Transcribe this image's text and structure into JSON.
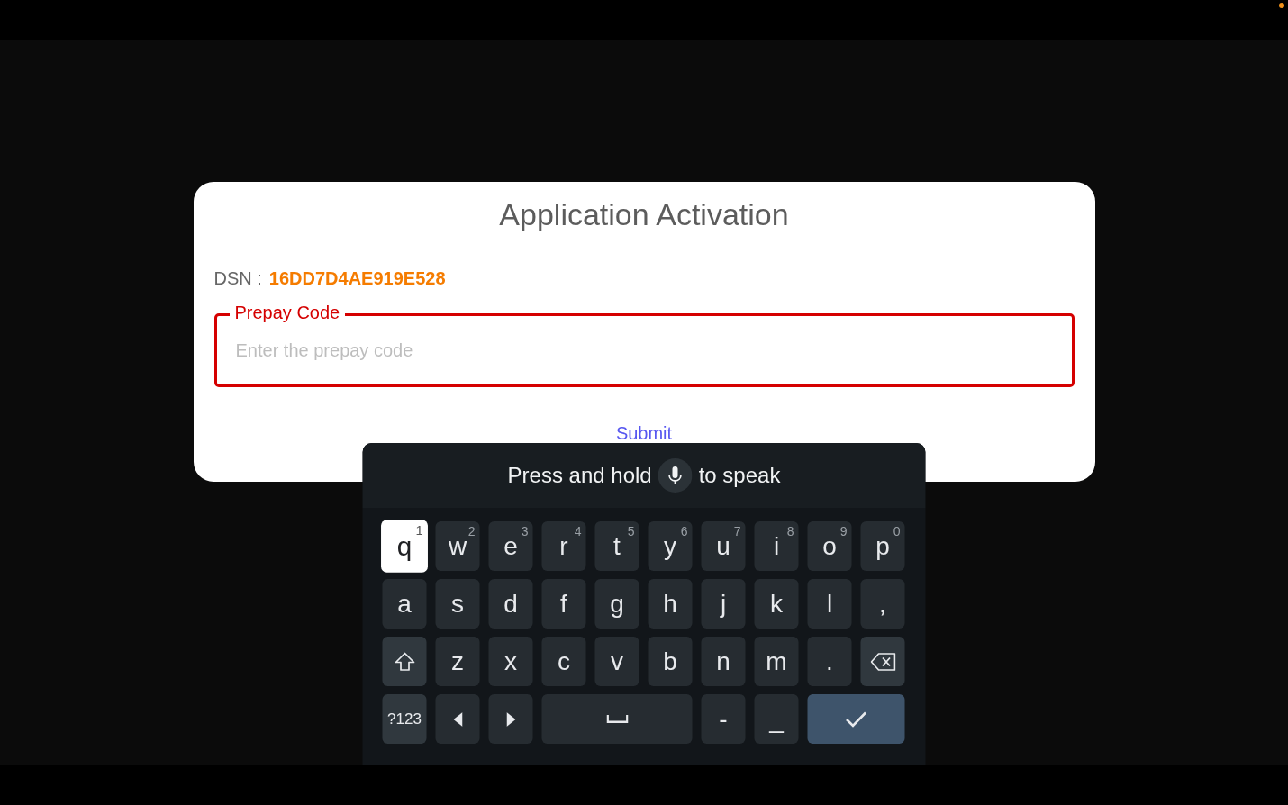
{
  "dialog": {
    "title": "Application Activation",
    "dsn": {
      "label": "DSN :",
      "value": "16DD7D4AE919E528"
    },
    "prepay_field": {
      "label": "Prepay Code",
      "placeholder": "Enter the prepay code",
      "focused": true
    },
    "submit": "Submit"
  },
  "keyboard": {
    "voice_prompt": {
      "before": "Press and hold",
      "after": "to speak"
    },
    "letter_rows": [
      [
        {
          "kind": "char",
          "label": "q",
          "hint": "1",
          "selected": true
        },
        {
          "kind": "char",
          "label": "w",
          "hint": "2",
          "selected": false
        },
        {
          "kind": "char",
          "label": "e",
          "hint": "3",
          "selected": false
        },
        {
          "kind": "char",
          "label": "r",
          "hint": "4",
          "selected": false
        },
        {
          "kind": "char",
          "label": "t",
          "hint": "5",
          "selected": false
        },
        {
          "kind": "char",
          "label": "y",
          "hint": "6",
          "selected": false
        },
        {
          "kind": "char",
          "label": "u",
          "hint": "7",
          "selected": false
        },
        {
          "kind": "char",
          "label": "i",
          "hint": "8",
          "selected": false
        },
        {
          "kind": "char",
          "label": "o",
          "hint": "9",
          "selected": false
        },
        {
          "kind": "char",
          "label": "p",
          "hint": "0",
          "selected": false
        }
      ],
      [
        {
          "kind": "char",
          "label": "a",
          "selected": false
        },
        {
          "kind": "char",
          "label": "s",
          "selected": false
        },
        {
          "kind": "char",
          "label": "d",
          "selected": false
        },
        {
          "kind": "char",
          "label": "f",
          "selected": false
        },
        {
          "kind": "char",
          "label": "g",
          "selected": false
        },
        {
          "kind": "char",
          "label": "h",
          "selected": false
        },
        {
          "kind": "char",
          "label": "j",
          "selected": false
        },
        {
          "kind": "char",
          "label": "k",
          "selected": false
        },
        {
          "kind": "char",
          "label": "l",
          "selected": false
        },
        {
          "kind": "char",
          "label": ",",
          "selected": false
        }
      ],
      [
        {
          "kind": "shift",
          "selected": false
        },
        {
          "kind": "char",
          "label": "z",
          "selected": false
        },
        {
          "kind": "char",
          "label": "x",
          "selected": false
        },
        {
          "kind": "char",
          "label": "c",
          "selected": false
        },
        {
          "kind": "char",
          "label": "v",
          "selected": false
        },
        {
          "kind": "char",
          "label": "b",
          "selected": false
        },
        {
          "kind": "char",
          "label": "n",
          "selected": false
        },
        {
          "kind": "char",
          "label": "m",
          "selected": false
        },
        {
          "kind": "char",
          "label": ".",
          "selected": false
        },
        {
          "kind": "backspace",
          "selected": false
        }
      ]
    ],
    "bottom_row": [
      {
        "kind": "symbols",
        "label": "?123",
        "selected": false
      },
      {
        "kind": "left",
        "selected": false
      },
      {
        "kind": "right",
        "selected": false
      },
      {
        "kind": "space",
        "selected": false
      },
      {
        "kind": "char",
        "label": "-",
        "selected": false
      },
      {
        "kind": "char",
        "label": "_",
        "selected": false
      },
      {
        "kind": "enter",
        "selected": false
      }
    ]
  }
}
